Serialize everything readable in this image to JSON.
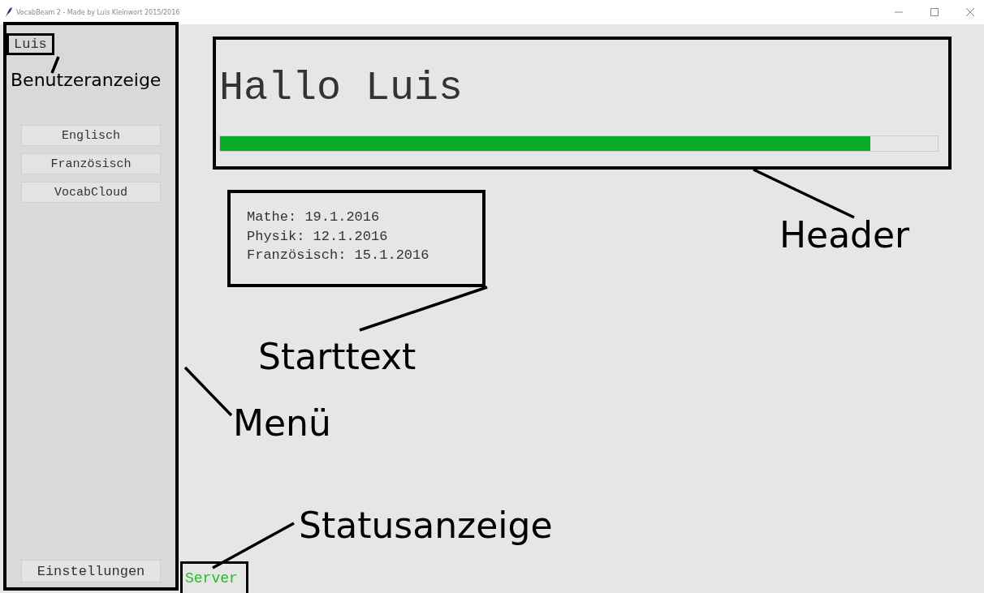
{
  "window": {
    "title": "VocabBeam 2 - Made by Luis Kleinwort 2015/2016"
  },
  "sidebar": {
    "user": "Luis",
    "buttons": [
      "Englisch",
      "Französisch",
      "VocabCloud"
    ],
    "settings_button": "Einstellungen"
  },
  "header": {
    "greeting": "Hallo Luis",
    "progress": {
      "level": 0.906
    }
  },
  "start_text": [
    "Mathe: 19.1.2016",
    "Physik: 12.1.2016",
    "Französisch: 15.1.2016"
  ],
  "status": {
    "text": "Server",
    "color": "#2eb82e"
  },
  "annotations": [
    "Benutzeranzeige",
    "Header",
    "Starttext",
    "Menü",
    "Statusanzeige"
  ]
}
